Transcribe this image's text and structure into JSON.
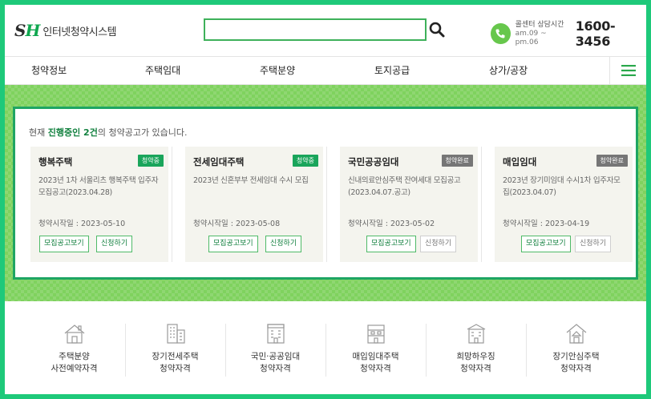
{
  "header": {
    "logo_mark_s": "S",
    "logo_mark_h": "H",
    "logo_text": "인터넷청약시스템",
    "search_placeholder": "",
    "call_label": "콜센터 상담시간",
    "call_hours": "am.09 ~ pm.06",
    "call_number": "1600-3456"
  },
  "nav": {
    "items": [
      "청약정보",
      "주택임대",
      "주택분양",
      "토지공급",
      "상가/공장"
    ]
  },
  "panel": {
    "notice_pre": "현재 ",
    "notice_highlight": "진행중인 2건",
    "notice_post": "의 청약공고가 있습니다.",
    "cards": [
      {
        "title": "행복주택",
        "badge": "청약중",
        "desc": "2023년 1차 서울리츠 행복주택 입주자 모집공고(2023.04.28)",
        "date": "청약시작일 : 2023-05-10",
        "view_label": "모집공고보기",
        "apply_label": "신청하기"
      },
      {
        "title": "전세임대주택",
        "badge": "청약중",
        "desc": "2023년 신혼부부 전세임대 수시 모집",
        "date": "청약시작일 : 2023-05-08",
        "view_label": "모집공고보기",
        "apply_label": "신청하기"
      },
      {
        "title": "국민공공임대",
        "badge": "청약완료",
        "desc": "신내의료안심주택 잔여세대 모집공고(2023.04.07.공고)",
        "date": "청약시작일 : 2023-05-02",
        "view_label": "모집공고보기",
        "apply_label": "신청하기"
      },
      {
        "title": "매입임대",
        "badge": "청약완료",
        "desc": "2023년 장기미임대 수시1차 입주자모집(2023.04.07)",
        "date": "청약시작일 : 2023-04-19",
        "view_label": "모집공고보기",
        "apply_label": "신청하기"
      }
    ]
  },
  "quick_links": [
    {
      "line1": "주택분양",
      "line2": "사전예약자격",
      "icon": "house-icon"
    },
    {
      "line1": "장기전세주택",
      "line2": "청약자격",
      "icon": "apartment-icon"
    },
    {
      "line1": "국민·공공임대",
      "line2": "청약자격",
      "icon": "building-icon"
    },
    {
      "line1": "매입임대주택",
      "line2": "청약자격",
      "icon": "rowhouse-icon"
    },
    {
      "line1": "희망하우징",
      "line2": "청약자격",
      "icon": "dormitory-icon"
    },
    {
      "line1": "장기안심주택",
      "line2": "청약자격",
      "icon": "safe-house-icon"
    }
  ],
  "colors": {
    "brand_green": "#1ea563",
    "outer_border": "#1ec97a",
    "band_green": "#7fd25e",
    "badge_closed": "#767676"
  }
}
